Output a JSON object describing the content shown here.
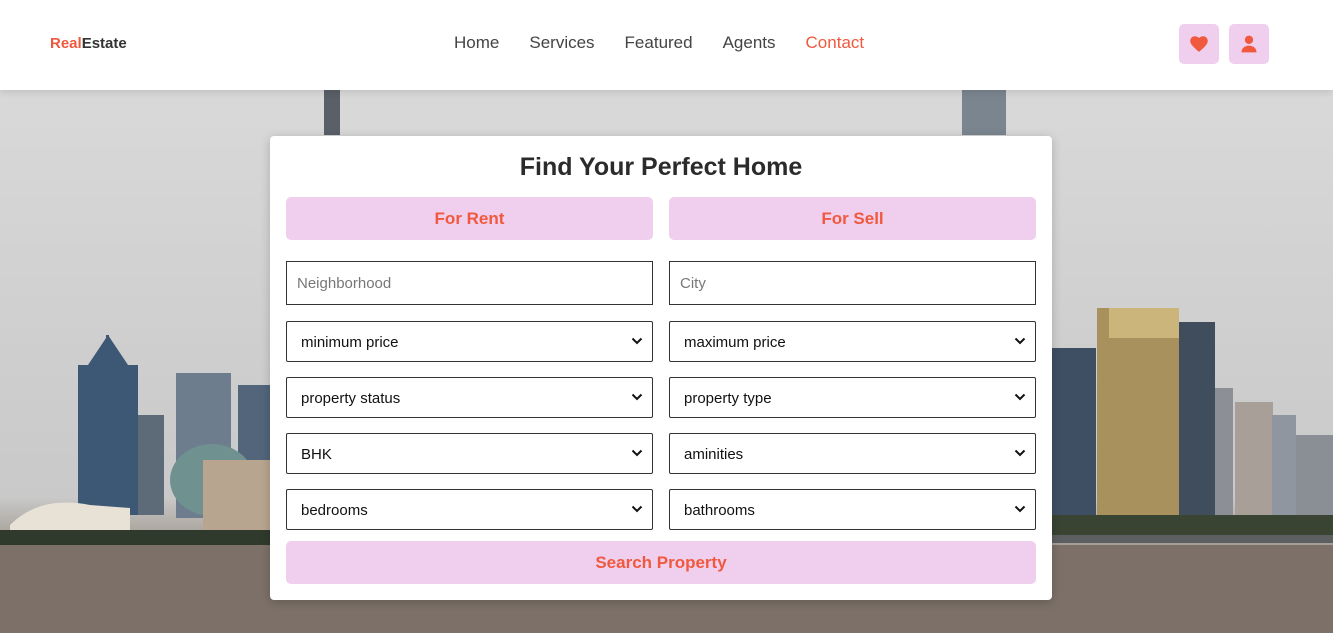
{
  "header": {
    "logo_accent": "Real",
    "logo_rest": "Estate",
    "nav": [
      {
        "label": "Home"
      },
      {
        "label": "Services"
      },
      {
        "label": "Featured"
      },
      {
        "label": "Agents"
      },
      {
        "label": "Contact"
      }
    ],
    "active_nav": "Contact",
    "icons": [
      "heart-icon",
      "user-icon"
    ]
  },
  "search": {
    "title": "Find Your Perfect Home",
    "tabs": [
      "For Rent",
      "For Sell"
    ],
    "neighborhood_placeholder": "Neighborhood",
    "city_placeholder": "City",
    "selects": {
      "min_price": "minimum price",
      "max_price": "maximum price",
      "property_status": "property status",
      "property_type": "property type",
      "bhk": "BHK",
      "aminities": "aminities",
      "bedrooms": "bedrooms",
      "bathrooms": "bathrooms"
    },
    "submit_label": "Search Property"
  },
  "colors": {
    "accent": "#f0593e",
    "button_bg": "#f0cfee"
  }
}
